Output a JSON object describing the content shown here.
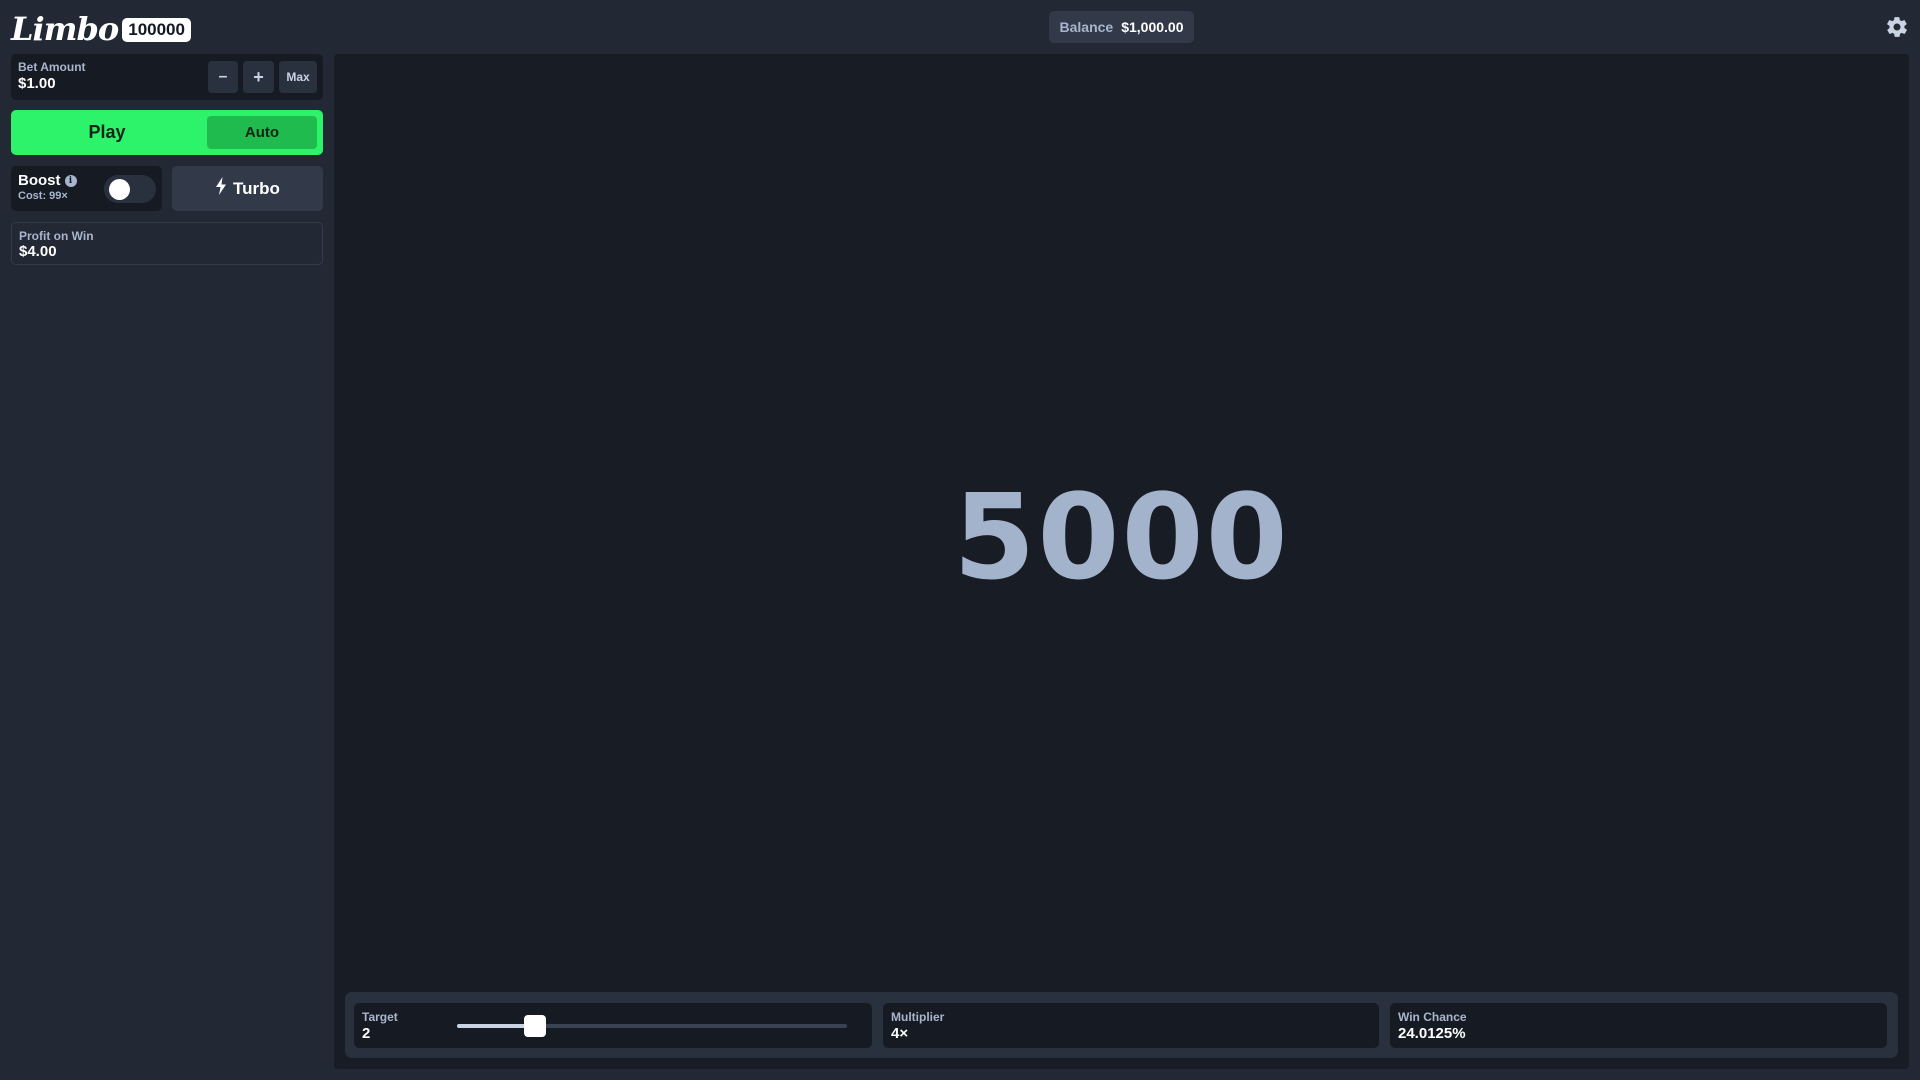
{
  "header": {
    "logo_text": "Limbo",
    "logo_badge": "100000",
    "balance_label": "Balance",
    "balance_value": "$1,000.00",
    "settings_icon": "gear-icon"
  },
  "sidebar": {
    "bet": {
      "label": "Bet Amount",
      "value": "$1.00",
      "minus_label": "–",
      "plus_label": "+",
      "max_label": "Max"
    },
    "play_label": "Play",
    "auto_label": "Auto",
    "boost": {
      "label": "Boost",
      "info_icon": "info-icon",
      "cost_label": "Cost: 99×",
      "enabled": false
    },
    "turbo": {
      "label": "Turbo",
      "icon": "lightning-bolt-icon"
    },
    "profit": {
      "label": "Profit on Win",
      "value": "$4.00"
    }
  },
  "game": {
    "result": "5000"
  },
  "controls": {
    "target": {
      "label": "Target",
      "value": "2",
      "slider_fraction": 0.2
    },
    "multiplier": {
      "label": "Multiplier",
      "value": "4×"
    },
    "win_chance": {
      "label": "Win Chance",
      "value": "24.0125%"
    }
  },
  "colors": {
    "accent_green": "#2cf36a",
    "auto_green": "#1fbb4f",
    "background": "#222834",
    "game_background": "#181c24",
    "result_text": "#a3b3cb"
  }
}
